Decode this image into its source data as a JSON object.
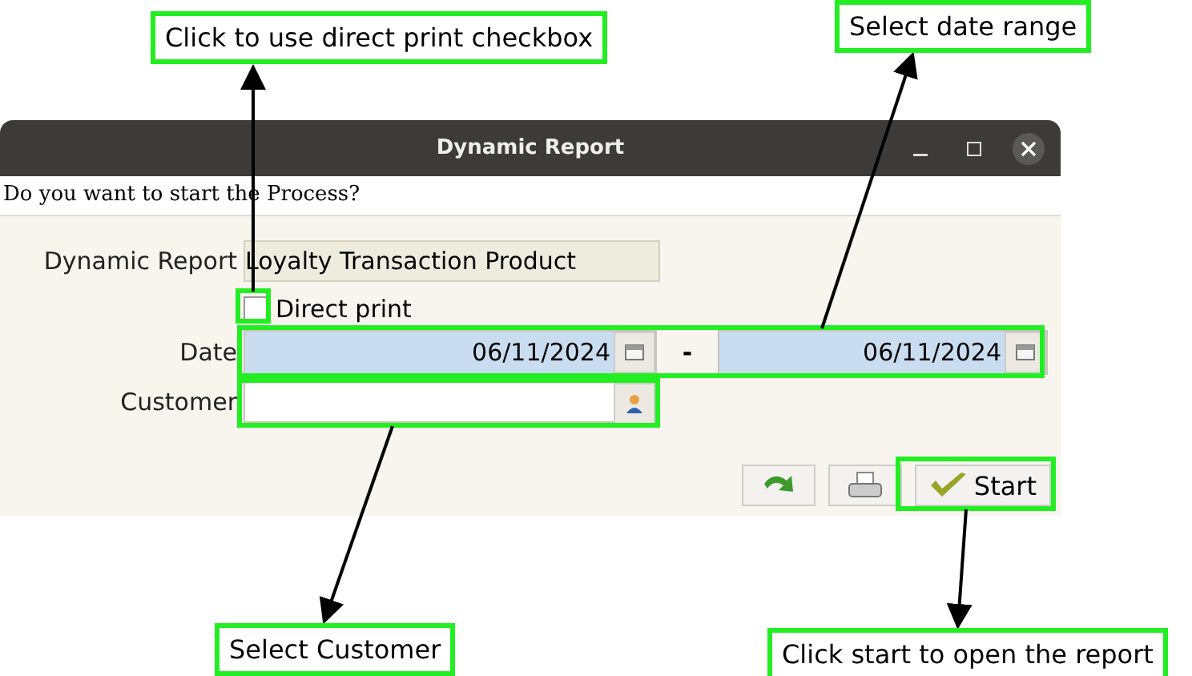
{
  "window": {
    "title": "Dynamic Report"
  },
  "prompt": "Do you want to start the Process?",
  "form": {
    "report_label": "Dynamic Report",
    "report_value": "Loyalty Transaction Product",
    "direct_print": {
      "label": "Direct print",
      "checked": false
    },
    "date_label": "Date",
    "date_from": "06/11/2024",
    "date_separator": "-",
    "date_to": "06/11/2024",
    "customer_label": "Customer"
  },
  "buttons": [
    {
      "kind": "redo"
    },
    {
      "kind": "print"
    },
    {
      "kind": "start",
      "label": "Start"
    }
  ],
  "callouts": [
    {
      "text": "Click to use direct print checkbox"
    },
    {
      "text": "Select date range"
    },
    {
      "text": "Select Customer"
    },
    {
      "text": "Click start to open the report"
    }
  ]
}
